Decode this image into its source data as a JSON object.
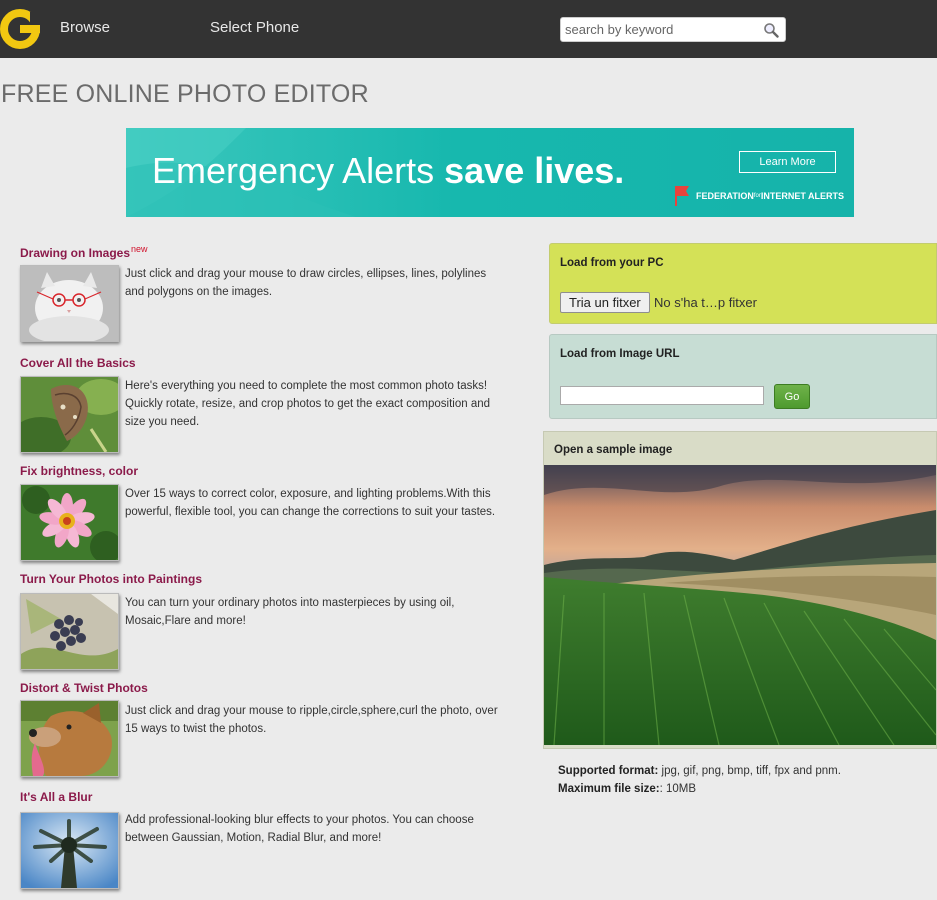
{
  "header": {
    "logo_icon": "logo-icon",
    "nav": [
      {
        "label": "Browse"
      },
      {
        "label": "Select Phone"
      }
    ],
    "search": {
      "placeholder": "search by keyword",
      "value": "",
      "icon": "search-icon"
    }
  },
  "page_title": "FREE ONLINE PHOTO EDITOR",
  "ad": {
    "headline_regular": "Emergency Alerts ",
    "headline_bold": "save lives.",
    "cta": "Learn More",
    "sponsor_icon": "flag-icon",
    "sponsor_a": "FEDERATION ",
    "sponsor_small": "for",
    "sponsor_b": " INTERNET ALERTS",
    "colors": {
      "background": "#17b8ae"
    }
  },
  "features": [
    {
      "title": "Drawing on Images",
      "badge": "new",
      "description": "Just click and drag your mouse to draw circles, ellipses, lines, polylines and polygons on the images."
    },
    {
      "title": "Cover All the Basics",
      "description": "Here's everything you need to complete the most common photo tasks! Quickly rotate, resize, and crop photos to get the exact composition and size you need."
    },
    {
      "title": "Fix brightness, color",
      "description": "Over 15 ways to correct color, exposure, and lighting problems.With this powerful, flexible tool, you can change the corrections to suit your tastes."
    },
    {
      "title": "Turn Your Photos into Paintings",
      "description": "You can turn your ordinary photos into masterpieces by using oil, Mosaic,Flare and more!"
    },
    {
      "title": "Distort & Twist Photos",
      "description": "Just click and drag your mouse to ripple,circle,sphere,curl the photo, over 15 ways to twist the photos."
    },
    {
      "title": "It's All a Blur",
      "description": "Add professional-looking blur effects to your photos. You can choose between Gaussian, Motion, Radial Blur, and more!"
    }
  ],
  "load_pc": {
    "heading": "Load from your PC",
    "button": "Tria un fitxer",
    "status": "No s'ha t…p fitxer"
  },
  "load_url": {
    "heading": "Load from Image URL",
    "value": "",
    "button": "Go"
  },
  "sample": {
    "heading": "Open a sample image"
  },
  "info": {
    "formats_label": "Supported format:",
    "formats_value": " jpg, gif, png, bmp, tiff, fpx and pnm.",
    "size_label": "Maximum file size:",
    "size_value": ": 10MB"
  },
  "colors": {
    "topbar": "#333333",
    "accent": "#8b1a4a",
    "logo": "#f2c811",
    "panel_pc": "#d4e157",
    "panel_url": "#c7ddd4",
    "go_button": "#5aa53a"
  }
}
